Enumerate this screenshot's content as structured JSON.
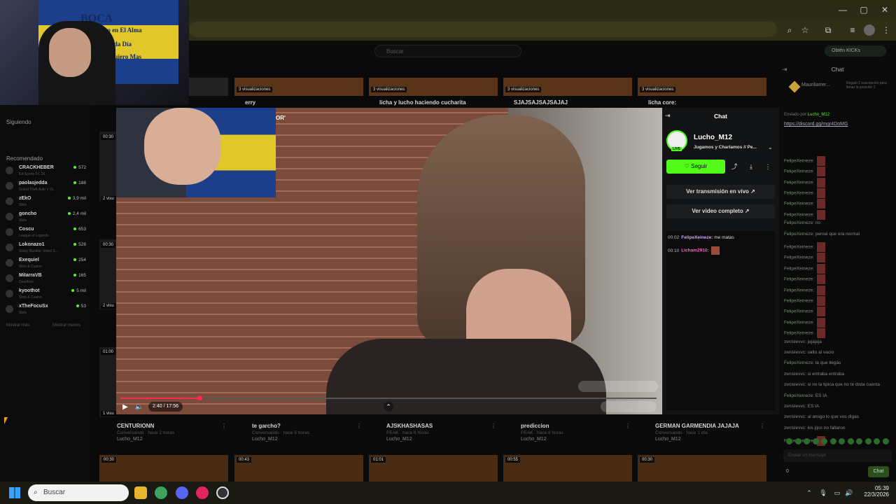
{
  "browser": {
    "window_buttons": [
      "—",
      "▢",
      "✕"
    ]
  },
  "kick": {
    "search_placeholder": "Buscar",
    "obtain_kicks": "Obtén KICKs",
    "sidebar": {
      "following_title": "Siguiendo",
      "recommended_title": "Recomendado",
      "recommended": [
        {
          "name": "CRACKHEBER",
          "sub": "EA Sports FC 26",
          "count": "572"
        },
        {
          "name": "paolasjedda",
          "sub": "Grand Theft Auto V (G...",
          "count": "188"
        },
        {
          "name": "zEkO",
          "sub": "Slots",
          "count": "3,9 mil"
        },
        {
          "name": "goncho",
          "sub": "Slots",
          "count": "2,4 mil"
        },
        {
          "name": "Coscu",
          "sub": "League of Legends",
          "count": "653"
        },
        {
          "name": "Lokonazo1",
          "sub": "Sticky Bandits: Voted S...",
          "count": "528"
        },
        {
          "name": "Exequiel",
          "sub": "Slots & Casino",
          "count": "254"
        },
        {
          "name": "MiIarraVB",
          "sub": "Deadlock",
          "count": "165"
        },
        {
          "name": "kyoothot",
          "sub": "Slots & Casino",
          "count": "5 mil"
        },
        {
          "name": "xTheFocuSx",
          "sub": "Slots",
          "count": "53"
        }
      ],
      "show_more": "Mostrar más",
      "show_less": "Mostrar menos"
    },
    "top_thumbs": [
      {
        "label": "",
        "title": ""
      },
      {
        "label": "3 visualizaciones",
        "title": "erry"
      },
      {
        "label": "3 visualizaciones",
        "title": "licha y lucho haciendo cucharita"
      },
      {
        "label": "3 visualizaciones",
        "title": "SJAJSAJSAJSAJAJ"
      },
      {
        "label": "3 visualizaciones",
        "title": "licha core:"
      }
    ],
    "videos": [
      {
        "title": "CENTURIONN",
        "meta": "Conversando · hace 2 horas",
        "channel": "Lucho_M12"
      },
      {
        "title": "te garcho?",
        "meta": "Conversando · hace 5 horas",
        "channel": "Lucho_M12"
      },
      {
        "title": "AJSKHASHASAS",
        "meta": "PEAK · hace 6 horas",
        "channel": "Lucho_M12"
      },
      {
        "title": "prediccion",
        "meta": "PEAK · hace 8 horas",
        "channel": "Lucho_M12"
      },
      {
        "title": "GERMAN GARMENDIA JAJAJA",
        "meta": "Conversando · hace 1 día",
        "channel": "Lucho_M12"
      }
    ],
    "bottom_thumbs": [
      "00:30",
      "00:43",
      "01:01",
      "00:55",
      "00:30"
    ],
    "left_col_badges": [
      "00:30",
      "2 visu",
      "00:30",
      "2 visu",
      "01:00",
      "1 visu"
    ]
  },
  "player": {
    "pip_label": "OR'",
    "time": "2:40 / 17:56",
    "progress": 0.148
  },
  "modal_chat": {
    "title": "Chat",
    "live": "LIVE",
    "streamer": "Lucho_M12",
    "stream_title": "Jugamos y Charlamos // Pe...",
    "follow": "Seguir",
    "watch_live": "Ver transmisión en vivo",
    "watch_full": "Ver video completo",
    "messages": [
      {
        "time": "00:02",
        "user": "FelipeXeineze:",
        "text": "me matas"
      },
      {
        "time": "00:10",
        "user": "Licham2910:",
        "text": ""
      }
    ]
  },
  "page_chat": {
    "title": "Chat",
    "pinned_user": "Mauriliarrer...",
    "pinned_text": "Regaló 1 suscripción para llenar la posición 1",
    "sent_by": "Enviado por",
    "sent_by_user": "Lucho_M12",
    "link": "https://discord.gg/mgr4DoMG",
    "messages": [
      {
        "user": "",
        "text": ""
      },
      {
        "user": "",
        "text": ""
      },
      {
        "user": "FelipeXeineze:",
        "text": "",
        "emote": true
      },
      {
        "user": "FelipeXeineze:",
        "text": "",
        "emote": true
      },
      {
        "user": "FelipeXeineze:",
        "text": "",
        "emote": true
      },
      {
        "user": "FelipeXeineze:",
        "text": "",
        "emote": true
      },
      {
        "user": "FelipeXeineze:",
        "text": "",
        "emote": true
      },
      {
        "user": "FelipeXeineze:",
        "text": "",
        "emote": true
      },
      {
        "user": "FelipeXeineze:",
        "text": "no",
        "emote": false
      },
      {
        "user": "FelipeXeineze:",
        "text": "pensé que era normal",
        "emote": false
      },
      {
        "user": "FelipeXeineze:",
        "text": "",
        "emote": true
      },
      {
        "user": "FelipeXeineze:",
        "text": "",
        "emote": true
      },
      {
        "user": "FelipeXeineze:",
        "text": "",
        "emote": true
      },
      {
        "user": "FelipeXeineze:",
        "text": "",
        "emote": true
      },
      {
        "user": "FelipeXeineze:",
        "text": "",
        "emote": true
      },
      {
        "user": "FelipeXeineze:",
        "text": "",
        "emote": true
      },
      {
        "user": "FelipeXeineze:",
        "text": "",
        "emote": true
      },
      {
        "user": "FelipeXeineze:",
        "text": "",
        "emote": true
      },
      {
        "user": "FelipeXeineze:",
        "text": "",
        "emote": true
      },
      {
        "user": "zenislevvc:",
        "text": "jajajaja",
        "emote": false
      },
      {
        "user": "zenislevvc:",
        "text": "salto al vacio",
        "emote": false
      },
      {
        "user": "FelipeXeineze:",
        "text": "la que llegás",
        "emote": false
      },
      {
        "user": "zenislevvc:",
        "text": "si entraba entraba",
        "emote": false
      },
      {
        "user": "zenislevvc:",
        "text": "si no la tipica que no te dista cuenta",
        "emote": false
      },
      {
        "user": "FelipeXeineze:",
        "text": "ES IA",
        "emote": false
      },
      {
        "user": "zenislevvc:",
        "text": "ES IA",
        "emote": false
      },
      {
        "user": "zenislevvc:",
        "text": "al amigo lo que vos digas",
        "emote": false
      },
      {
        "user": "zenislevvc:",
        "text": "los jijos no faltaron",
        "emote": false
      },
      {
        "user": "FelipeXeineze:",
        "text": "",
        "emote": true
      }
    ],
    "input_placeholder": "Enviar un mensaje",
    "chat_button": "Chat",
    "points": "0"
  },
  "taskbar": {
    "search": "Buscar",
    "time": "05:39",
    "date": "22/3/2026"
  },
  "colors": {
    "accent": "#53fc18",
    "progress": "#ff2a4f"
  }
}
